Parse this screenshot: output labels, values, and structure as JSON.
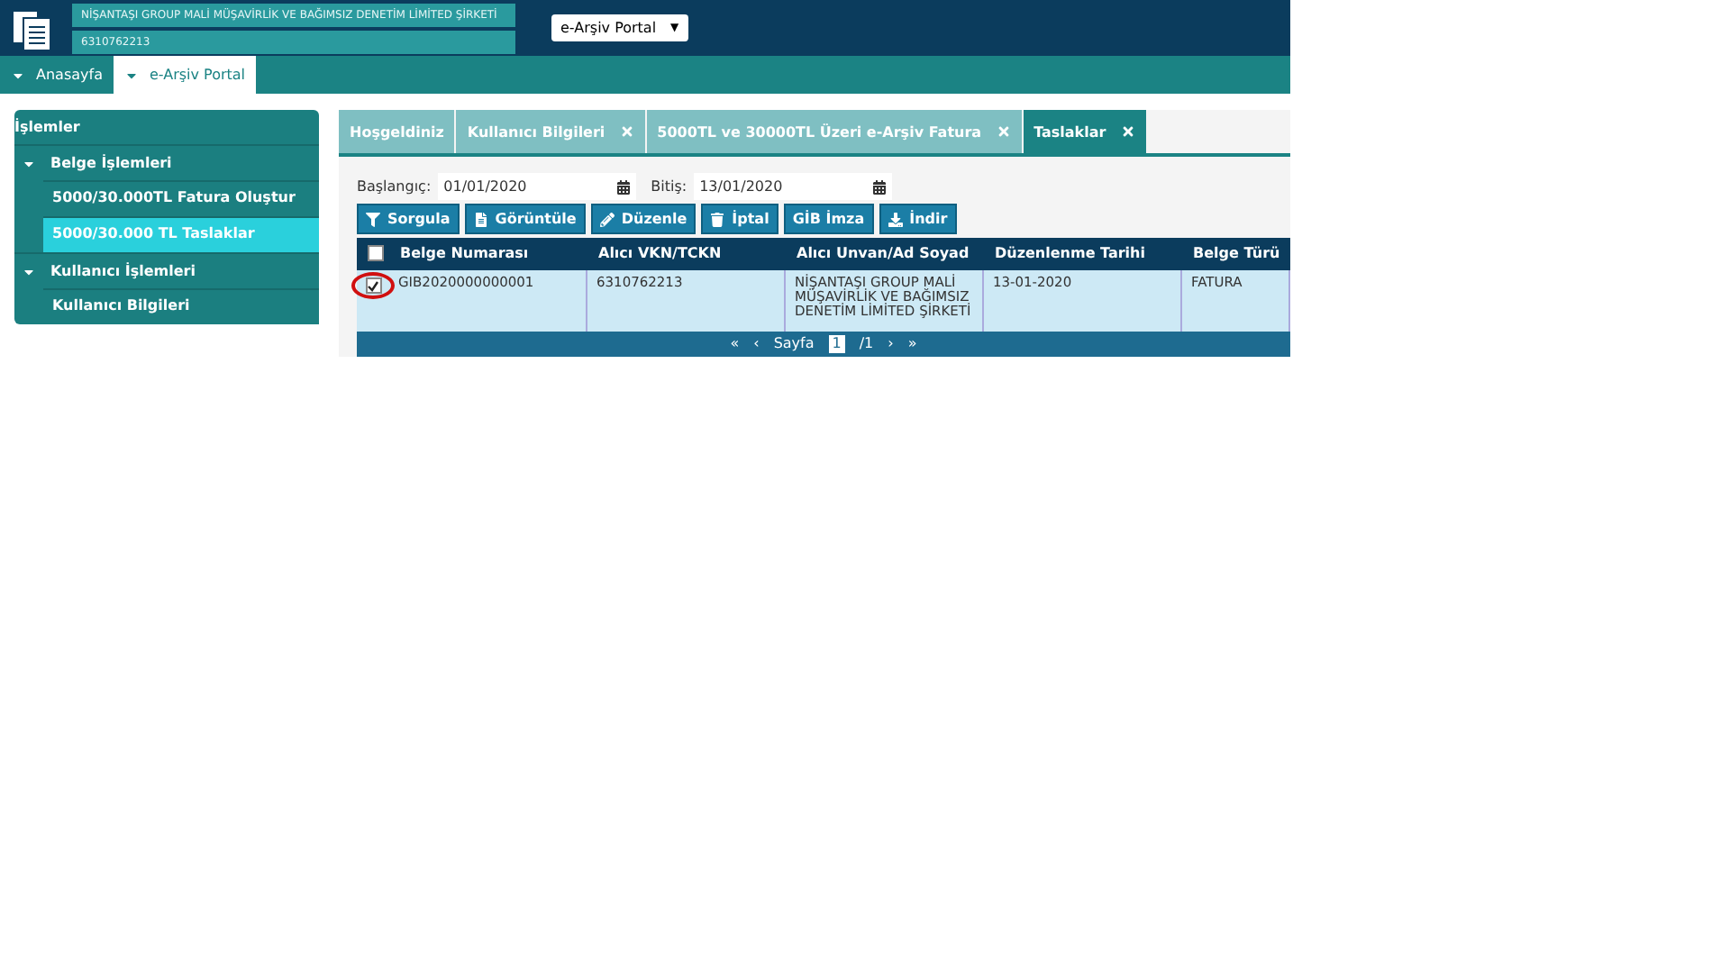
{
  "header": {
    "company": "NİŞANTAŞI GROUP MALİ MÜŞAVİRLİK VE BAĞIMSIZ DENETİM LİMİTED ŞİRKETİ",
    "tax_id": "6310762213",
    "portal_select": {
      "value": "e-Arşiv Portal",
      "caret": "▼"
    }
  },
  "nav": [
    {
      "label": "Anasayfa",
      "selected": false
    },
    {
      "label": "e-Arşiv Portal",
      "selected": true
    }
  ],
  "sidebar": {
    "title": "İşlemler",
    "items": [
      {
        "label": "Belge İşlemleri",
        "expanded": true,
        "children": [
          {
            "label": "5000/30.000TL Fatura Oluştur",
            "selected": false
          },
          {
            "label": "5000/30.000 TL Taslaklar",
            "selected": true
          }
        ]
      },
      {
        "label": "Kullanıcı İşlemleri",
        "expanded": true,
        "children": [
          {
            "label": "Kullanıcı Bilgileri",
            "selected": false
          }
        ]
      }
    ]
  },
  "tabs": [
    {
      "label": "Hoşgeldiniz",
      "closable": false,
      "selected": false
    },
    {
      "label": "Kullanıcı Bilgileri",
      "closable": true,
      "selected": false
    },
    {
      "label": "5000TL ve 30000TL Üzeri e-Arşiv Fatura",
      "closable": true,
      "selected": false
    },
    {
      "label": "Taslaklar",
      "closable": true,
      "selected": true
    }
  ],
  "filters": [
    {
      "label": "Başlangıç:",
      "value": "01/01/2020"
    },
    {
      "label": "Bitiş:",
      "value": "13/01/2020"
    }
  ],
  "buttons": [
    {
      "label": "Sorgula",
      "kind": "filter"
    },
    {
      "label": "Görüntüle",
      "kind": "file"
    },
    {
      "label": "Düzenle",
      "kind": "edit"
    },
    {
      "label": "İptal",
      "kind": "trash"
    },
    {
      "label": "GİB İmza",
      "kind": "none"
    },
    {
      "label": "İndir",
      "kind": "download"
    }
  ],
  "table": {
    "select_all": false,
    "columns": [
      "Belge Numarası",
      "Alıcı VKN/TCKN",
      "Alıcı Unvan/Ad Soyad",
      "Düzenlenme Tarihi",
      "Belge Türü"
    ],
    "rows": [
      {
        "checked": true,
        "highlighted": true,
        "cells": [
          "GIB2020000000001",
          "6310762213",
          "NİŞANTAŞI GROUP MALİ MÜŞAVİRLİK VE BAĞIMSIZ DENETİM LİMİTED ŞİRKETİ",
          "13-01-2020",
          "FATURA"
        ]
      }
    ]
  },
  "pager": {
    "first": "«",
    "prev": "‹",
    "label": "Sayfa",
    "page": "1",
    "total": "/1",
    "next": "›",
    "last": "»"
  }
}
